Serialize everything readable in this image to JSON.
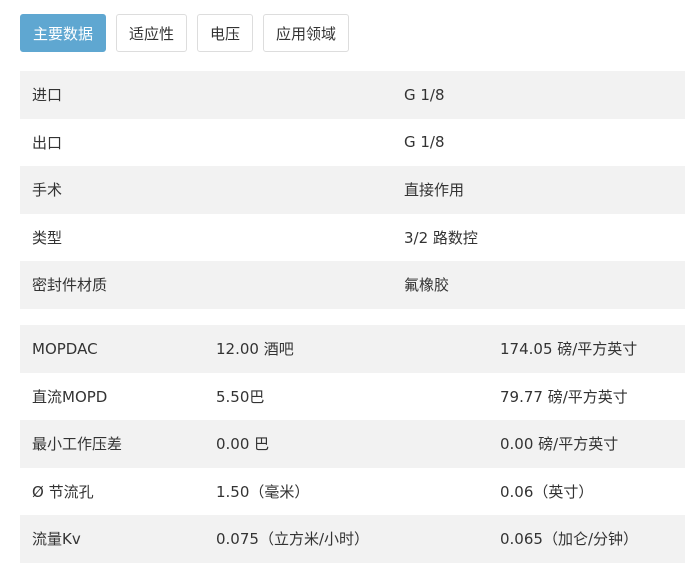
{
  "tabs": [
    {
      "label": "主要数据",
      "active": true
    },
    {
      "label": "适应性",
      "active": false
    },
    {
      "label": "电压",
      "active": false
    },
    {
      "label": "应用领域",
      "active": false
    }
  ],
  "specs": [
    {
      "label": "进口",
      "value": "G 1/8"
    },
    {
      "label": "出口",
      "value": "G 1/8"
    },
    {
      "label": "手术",
      "value": "直接作用"
    },
    {
      "label": "类型",
      "value": "3/2 路数控"
    },
    {
      "label": "密封件材质",
      "value": "氟橡胶"
    }
  ],
  "pressure": [
    {
      "label": "MOPDAC",
      "metric": "12.00 酒吧",
      "imperial": "174.05 磅/平方英寸"
    },
    {
      "label": "直流MOPD",
      "metric": "5.50巴",
      "imperial": "79.77 磅/平方英寸"
    },
    {
      "label": "最小工作压差",
      "metric": "0.00 巴",
      "imperial": "0.00 磅/平方英寸"
    },
    {
      "label": "Ø 节流孔",
      "metric": "1.50（毫米）",
      "imperial": "0.06（英寸）"
    },
    {
      "label": "流量Kv",
      "metric": "0.075（立方米/小时）",
      "imperial": "0.065（加仑/分钟）"
    }
  ],
  "colors": {
    "accent": "#5fa7d1",
    "row_shade": "#f2f2f2"
  }
}
